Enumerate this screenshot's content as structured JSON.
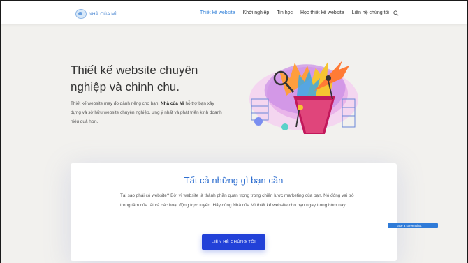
{
  "header": {
    "logo_text": "NHÀ CỦA MÌ",
    "nav": [
      {
        "label": "Thiết kế website",
        "active": true
      },
      {
        "label": "Khởi nghiệp",
        "active": false
      },
      {
        "label": "Tin học",
        "active": false
      },
      {
        "label": "Học thiết kế website",
        "active": false
      },
      {
        "label": "Liên hệ chúng tôi",
        "active": false
      }
    ],
    "search_icon": "search-icon"
  },
  "hero": {
    "title": "Thiết kế website chuyên nghiệp và chỉnh chu.",
    "text_prefix": "Thiết kế website may đo dành riêng cho bạn.",
    "brand": "Nhà của Mì",
    "text_suffix": "hỗ trợ bạn xây dựng và sở hữu website chuyên nghiệp, ưng ý nhất và phát triển kinh doanh hiệu quả hơn."
  },
  "card": {
    "title": "Tất cả những gì bạn cần",
    "text": "Tại sao phải có website? Bởi vì website là thành phần quan trọng trong chiến lược marketing của bạn. Nó đóng vai trò trọng tâm của tất cả các hoạt động trực tuyến. Hãy cùng Nhà của Mì thiết kế website cho bạn ngay trong hôm nay.",
    "button_label": "LIÊN HỆ CHÚNG TÔI"
  },
  "overlay": {
    "badge_label": "Take a screenshot"
  },
  "colors": {
    "accent": "#2f7fd8",
    "button": "#2241d8",
    "background": "#f2f1ee"
  }
}
